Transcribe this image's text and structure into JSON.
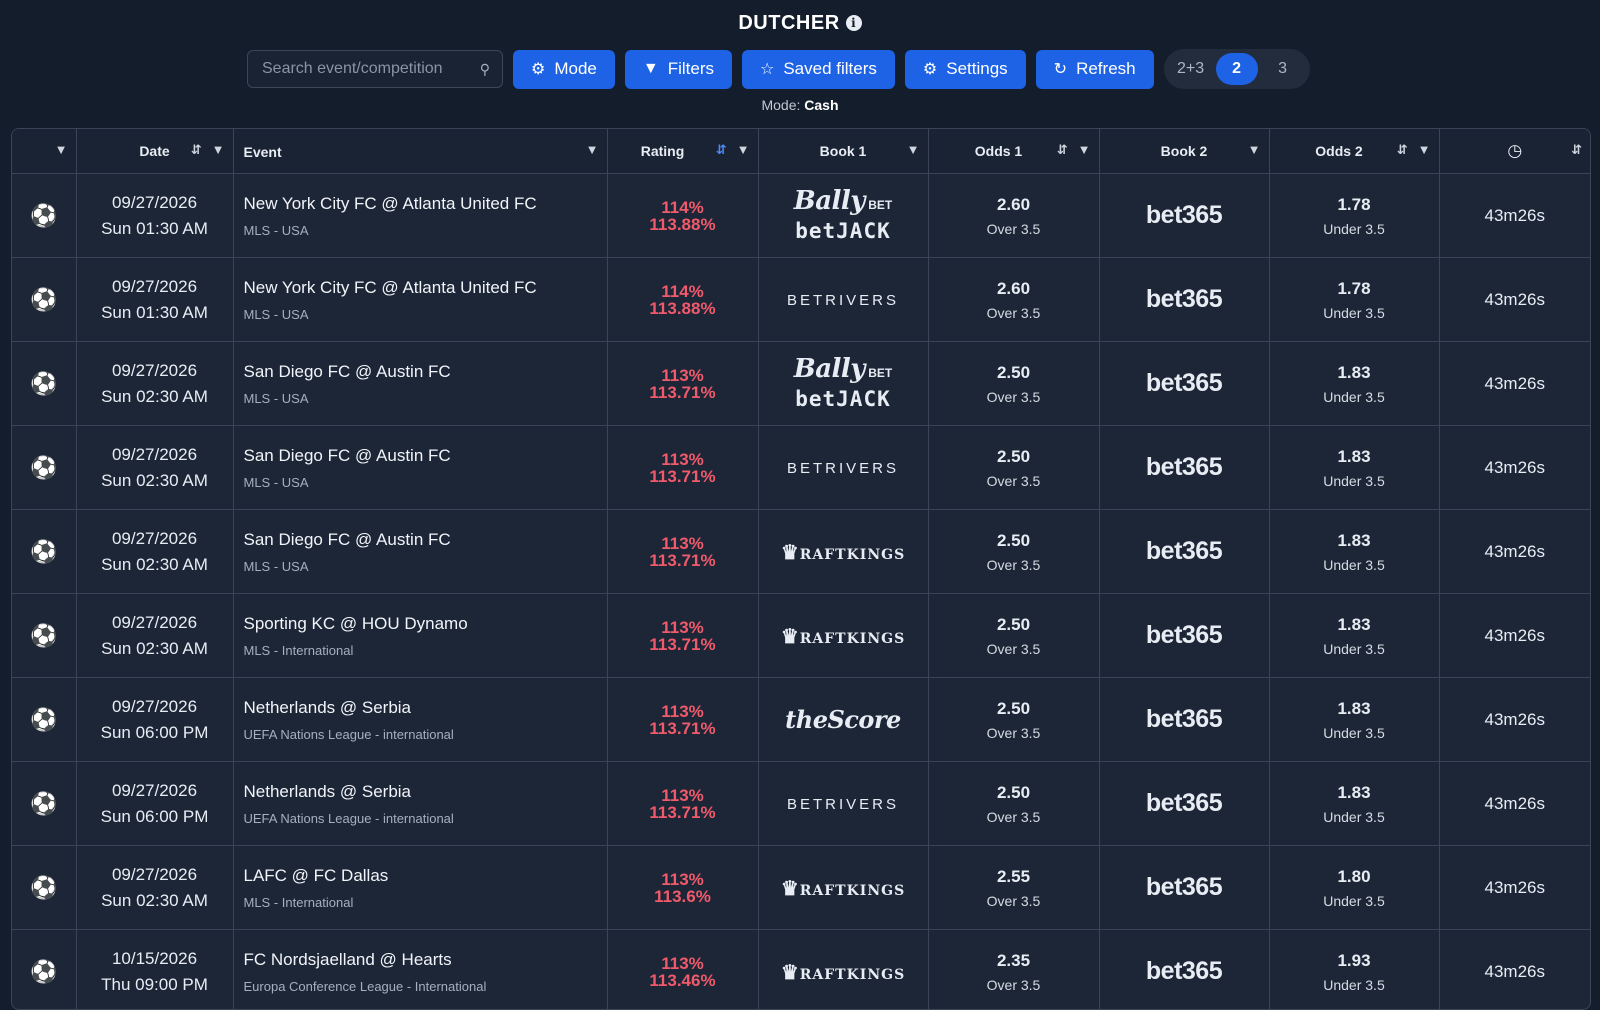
{
  "app": {
    "title": "DUTCHER"
  },
  "toolbar": {
    "search_placeholder": "Search event/competition",
    "mode_label": "Mode",
    "filters_label": "Filters",
    "saved_filters_label": "Saved filters",
    "settings_label": "Settings",
    "refresh_label": "Refresh",
    "segments": [
      "2+3",
      "2",
      "3"
    ],
    "active_segment": "2"
  },
  "mode_status": {
    "prefix": "Mode:",
    "value": "Cash"
  },
  "table": {
    "headers": {
      "date": "Date",
      "event": "Event",
      "rating": "Rating",
      "book1": "Book 1",
      "odds1": "Odds 1",
      "book2": "Book 2",
      "odds2": "Odds 2"
    },
    "rows": [
      {
        "date": "09/27/2026",
        "time": "Sun 01:30 AM",
        "event": "New York City FC @ Atlanta United FC",
        "competition": "MLS - USA",
        "rating_a": "114%",
        "rating_b": "113.88%",
        "book1": "BallyBet / betJACK",
        "odds1": "2.60",
        "market1": "Over 3.5",
        "book2": "bet365",
        "odds2": "1.78",
        "market2": "Under 3.5",
        "timer": "43m26s"
      },
      {
        "date": "09/27/2026",
        "time": "Sun 01:30 AM",
        "event": "New York City FC @ Atlanta United FC",
        "competition": "MLS - USA",
        "rating_a": "114%",
        "rating_b": "113.88%",
        "book1": "BETRIVERS",
        "odds1": "2.60",
        "market1": "Over 3.5",
        "book2": "bet365",
        "odds2": "1.78",
        "market2": "Under 3.5",
        "timer": "43m26s"
      },
      {
        "date": "09/27/2026",
        "time": "Sun 02:30 AM",
        "event": "San Diego FC @ Austin FC",
        "competition": "MLS - USA",
        "rating_a": "113%",
        "rating_b": "113.71%",
        "book1": "BallyBet / betJACK",
        "odds1": "2.50",
        "market1": "Over 3.5",
        "book2": "bet365",
        "odds2": "1.83",
        "market2": "Under 3.5",
        "timer": "43m26s"
      },
      {
        "date": "09/27/2026",
        "time": "Sun 02:30 AM",
        "event": "San Diego FC @ Austin FC",
        "competition": "MLS - USA",
        "rating_a": "113%",
        "rating_b": "113.71%",
        "book1": "BETRIVERS",
        "odds1": "2.50",
        "market1": "Over 3.5",
        "book2": "bet365",
        "odds2": "1.83",
        "market2": "Under 3.5",
        "timer": "43m26s"
      },
      {
        "date": "09/27/2026",
        "time": "Sun 02:30 AM",
        "event": "San Diego FC @ Austin FC",
        "competition": "MLS - USA",
        "rating_a": "113%",
        "rating_b": "113.71%",
        "book1": "DRAFTKINGS",
        "odds1": "2.50",
        "market1": "Over 3.5",
        "book2": "bet365",
        "odds2": "1.83",
        "market2": "Under 3.5",
        "timer": "43m26s"
      },
      {
        "date": "09/27/2026",
        "time": "Sun 02:30 AM",
        "event": "Sporting KC @ HOU Dynamo",
        "competition": "MLS - International",
        "rating_a": "113%",
        "rating_b": "113.71%",
        "book1": "DRAFTKINGS",
        "odds1": "2.50",
        "market1": "Over 3.5",
        "book2": "bet365",
        "odds2": "1.83",
        "market2": "Under 3.5",
        "timer": "43m26s"
      },
      {
        "date": "09/27/2026",
        "time": "Sun 06:00 PM",
        "event": "Netherlands @ Serbia",
        "competition": "UEFA Nations League - international",
        "rating_a": "113%",
        "rating_b": "113.71%",
        "book1": "theScore",
        "odds1": "2.50",
        "market1": "Over 3.5",
        "book2": "bet365",
        "odds2": "1.83",
        "market2": "Under 3.5",
        "timer": "43m26s"
      },
      {
        "date": "09/27/2026",
        "time": "Sun 06:00 PM",
        "event": "Netherlands @ Serbia",
        "competition": "UEFA Nations League - international",
        "rating_a": "113%",
        "rating_b": "113.71%",
        "book1": "BETRIVERS",
        "odds1": "2.50",
        "market1": "Over 3.5",
        "book2": "bet365",
        "odds2": "1.83",
        "market2": "Under 3.5",
        "timer": "43m26s"
      },
      {
        "date": "09/27/2026",
        "time": "Sun 02:30 AM",
        "event": "LAFC @ FC Dallas",
        "competition": "MLS - International",
        "rating_a": "113%",
        "rating_b": "113.6%",
        "book1": "DRAFTKINGS",
        "odds1": "2.55",
        "market1": "Over 3.5",
        "book2": "bet365",
        "odds2": "1.80",
        "market2": "Under 3.5",
        "timer": "43m26s"
      },
      {
        "date": "10/15/2026",
        "time": "Thu 09:00 PM",
        "event": "FC Nordsjaelland @ Hearts",
        "competition": "Europa Conference League - International",
        "rating_a": "113%",
        "rating_b": "113.46%",
        "book1": "DRAFTKINGS",
        "odds1": "2.35",
        "market1": "Over 3.5",
        "book2": "bet365",
        "odds2": "1.93",
        "market2": "Under 3.5",
        "timer": "43m26s"
      }
    ]
  },
  "colors": {
    "accent": "#1e63e6",
    "rating": "#f05a6a",
    "background": "#141d2b"
  }
}
